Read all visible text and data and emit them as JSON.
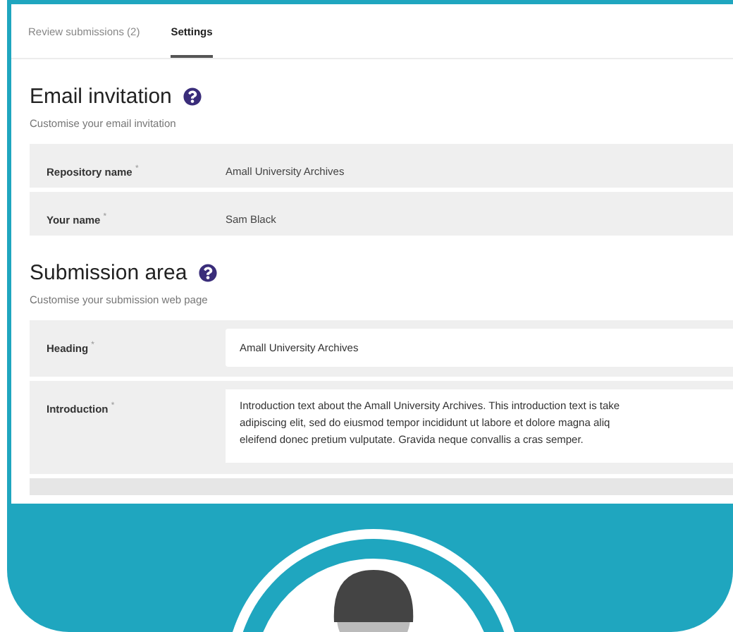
{
  "tabs": [
    {
      "label": "Review submissions (2)",
      "selected": false
    },
    {
      "label": "Settings",
      "selected": true
    }
  ],
  "sections": [
    {
      "title": "Email invitation",
      "subtitle": "Customise your email invitation",
      "fields": [
        {
          "kind": "static",
          "label": "Repository name $^{*}$",
          "value": "Amall University Archives"
        },
        {
          "kind": "static",
          "label": "Your name $^{*}$",
          "value": "Sam Black"
        }
      ]
    },
    {
      "title": "Submission area",
      "subtitle": "Customise your submission web page",
      "fields": [
        {
          "kind": "input",
          "label": "Heading $^{*}$",
          "value": "Amall University Archives"
        },
        {
          "kind": "textarea",
          "label": "Introduction $^{*}$",
          "lines": [
            "Introduction text about the Amall University Archives. This introduction text is take",
            "adipiscing elit, sed do eiusmod tempor incididunt ut labore et dolore magna aliq",
            "eleifend donec pretium vulputate. Gravida neque convallis a cras semper."
          ]
        }
      ]
    }
  ]
}
